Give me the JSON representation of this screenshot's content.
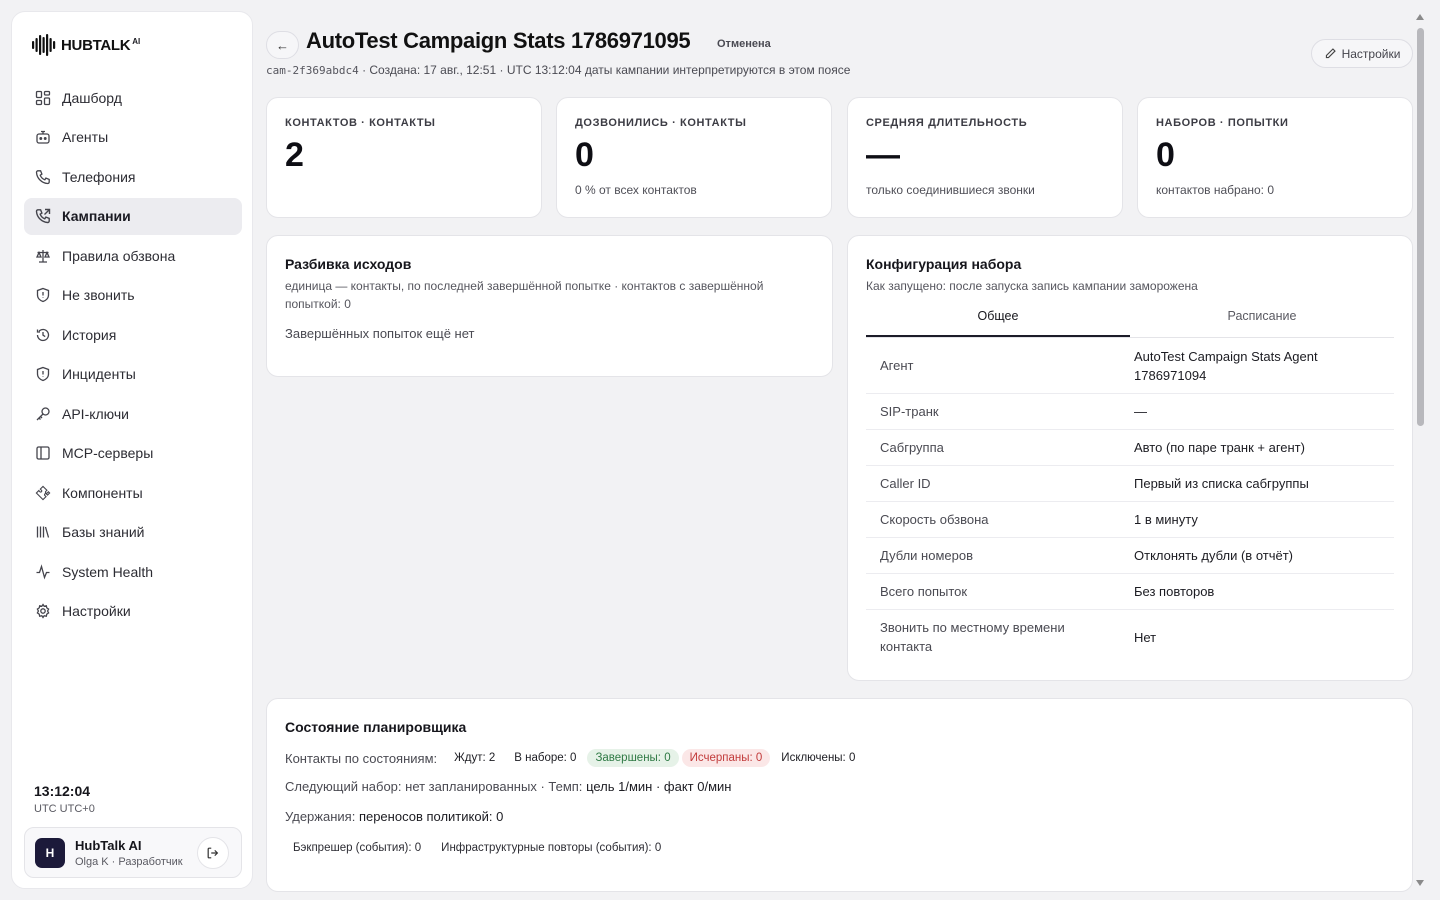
{
  "brand": {
    "name": "HUBTALK",
    "suffix": "AI"
  },
  "nav": [
    {
      "label": "Дашборд",
      "icon": "dashboard-icon"
    },
    {
      "label": "Агенты",
      "icon": "bot-icon"
    },
    {
      "label": "Телефония",
      "icon": "phone-icon"
    },
    {
      "label": "Кампании",
      "icon": "phone-outgoing-icon",
      "active": true
    },
    {
      "label": "Правила обзвона",
      "icon": "scale-icon"
    },
    {
      "label": "Не звонить",
      "icon": "shield-icon"
    },
    {
      "label": "История",
      "icon": "history-icon"
    },
    {
      "label": "Инциденты",
      "icon": "shield-alert-icon"
    },
    {
      "label": "API-ключи",
      "icon": "key-icon"
    },
    {
      "label": "MCP-серверы",
      "icon": "server-panel-icon"
    },
    {
      "label": "Компоненты",
      "icon": "puzzle-icon"
    },
    {
      "label": "Базы знаний",
      "icon": "library-icon"
    },
    {
      "label": "System Health",
      "icon": "activity-icon"
    },
    {
      "label": "Настройки",
      "icon": "gear-icon"
    }
  ],
  "clock": {
    "time": "13:12:04",
    "tz": "UTC UTC+0"
  },
  "user": {
    "initial": "H",
    "name": "HubTalk AI",
    "role": "Olga K · Разработчик"
  },
  "header": {
    "back": "←",
    "title": "AutoTest Campaign Stats 1786971095",
    "status": "Отменена",
    "campaign_id": "cam-2f369abdc4",
    "meta": "· Создана: 17 авг., 12:51 · UTC 13:12:04 даты кампании интерпретируются в этом поясе",
    "settings_label": "Настройки"
  },
  "stats": [
    {
      "label": "КОНТАКТОВ · КОНТАКТЫ",
      "value": "2",
      "sub": ""
    },
    {
      "label": "ДОЗВОНИЛИСЬ · КОНТАКТЫ",
      "value": "0",
      "sub": "0 % от всех контактов"
    },
    {
      "label": "СРЕДНЯЯ ДЛИТЕЛЬНОСТЬ",
      "value": "—",
      "sub": "только соединившиеся звонки"
    },
    {
      "label": "НАБОРОВ · ПОПЫТКИ",
      "value": "0",
      "sub": "контактов набрано: 0"
    }
  ],
  "outcomes": {
    "title": "Разбивка исходов",
    "desc": "единица — контакты, по последней завершённой попытке · контактов с завершённой попыткой: 0",
    "empty": "Завершённых попыток ещё нет"
  },
  "config": {
    "title": "Конфигурация набора",
    "desc": "Как запущено: после запуска запись кампании заморожена",
    "tabs": [
      "Общее",
      "Расписание"
    ],
    "rows": [
      {
        "key": "Агент",
        "value": "AutoTest Campaign Stats Agent 1786971094"
      },
      {
        "key": "SIP-транк",
        "value": "—"
      },
      {
        "key": "Сабгруппа",
        "value": "Авто (по паре транк + агент)"
      },
      {
        "key": "Caller ID",
        "value": "Первый из списка сабгруппы"
      },
      {
        "key": "Скорость обзвона",
        "value": "1 в минуту"
      },
      {
        "key": "Дубли номеров",
        "value": "Отклонять дубли (в отчёт)"
      },
      {
        "key": "Всего попыток",
        "value": "Без повторов"
      },
      {
        "key": "Звонить по местному времени контакта",
        "value": "Нет"
      }
    ]
  },
  "scheduler": {
    "title": "Состояние планировщика",
    "states_label": "Контакты по состояниям:",
    "states": [
      {
        "label": "Ждут: 2",
        "tone": "plain"
      },
      {
        "label": "В наборе: 0",
        "tone": "plain"
      },
      {
        "label": "Завершены: 0",
        "tone": "green"
      },
      {
        "label": "Исчерпаны: 0",
        "tone": "red"
      },
      {
        "label": "Исключены: 0",
        "tone": "plain"
      }
    ],
    "next_label": "Следующий набор:",
    "next_value": "нет запланированных",
    "pace_label": "· Темп:",
    "pace_value": "цель 1/мин · факт 0/мин",
    "holds_label": "Удержания:",
    "holds_value": "переносов политикой: 0",
    "backpressure": "Бэкпрешер (события): 0",
    "infra": "Инфраструктурные повторы (события): 0"
  }
}
